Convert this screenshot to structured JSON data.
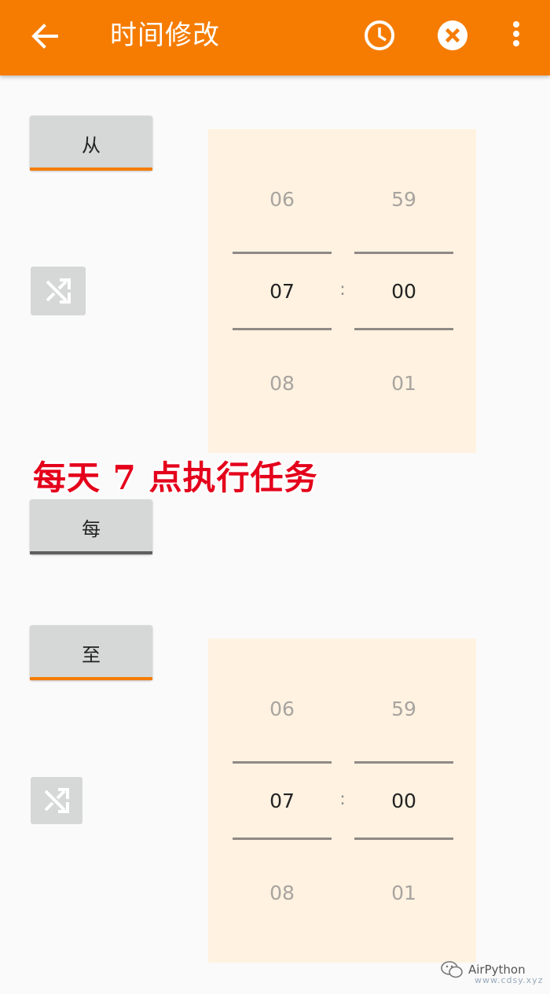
{
  "appbar": {
    "title": "时间修改",
    "back_icon": "arrow-back-icon",
    "clock_icon": "clock-icon",
    "cancel_icon": "close-circle-icon",
    "more_icon": "more-vert-icon",
    "color": "#f57c00"
  },
  "from_section": {
    "button_label": "从",
    "shuffle_icon": "shuffle-icon",
    "picker": {
      "hour_prev": "06",
      "hour": "07",
      "hour_next": "08",
      "separator": ":",
      "minute_prev": "59",
      "minute": "00",
      "minute_next": "01"
    }
  },
  "overlay_caption": "每天 7 点执行任务",
  "every_button_label": "每",
  "to_section": {
    "button_label": "至",
    "shuffle_icon": "shuffle-icon",
    "picker": {
      "hour_prev": "06",
      "hour": "07",
      "hour_next": "08",
      "separator": ":",
      "minute_prev": "59",
      "minute": "00",
      "minute_next": "01"
    }
  },
  "watermark": {
    "text": "AirPython",
    "url": "www.cdsy.xyz"
  },
  "colors": {
    "accent": "#f57c00",
    "picker_bg": "#fff2e1",
    "caption": "#e4001b"
  }
}
